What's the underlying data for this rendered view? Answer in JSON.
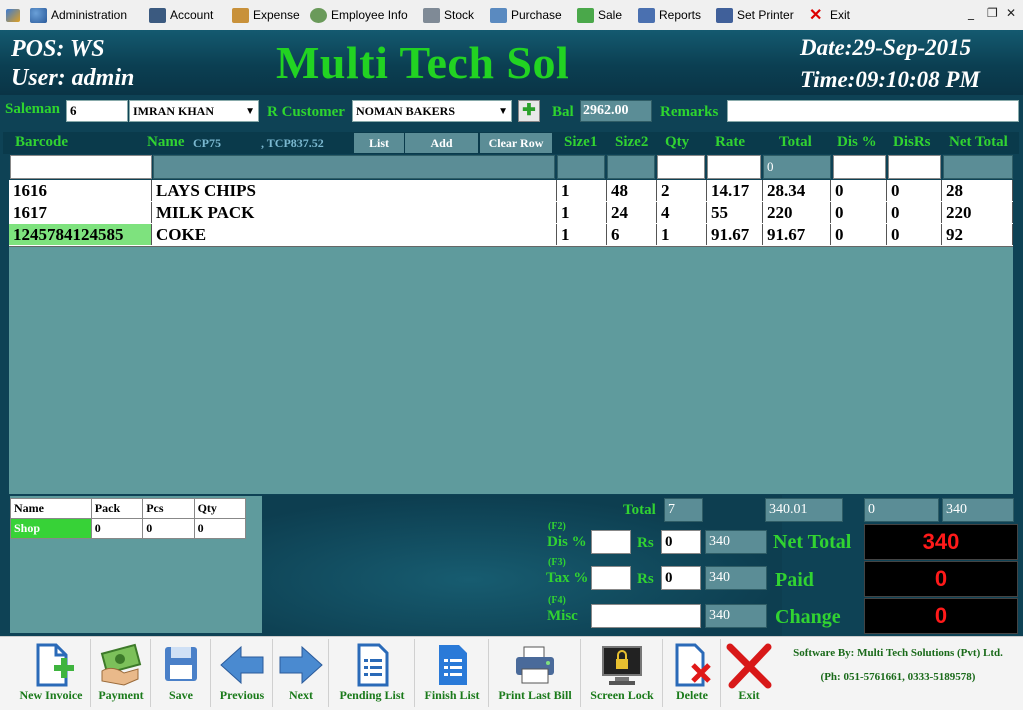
{
  "menu": {
    "items": [
      {
        "label": "Administration",
        "icon": "admin-users-icon"
      },
      {
        "label": "Account",
        "icon": "account-icon"
      },
      {
        "label": "Expense",
        "icon": "expense-box-icon"
      },
      {
        "label": "Employee Info",
        "icon": "employee-icon"
      },
      {
        "label": "Stock",
        "icon": "stock-cart-icon"
      },
      {
        "label": "Purchase",
        "icon": "purchase-icon"
      },
      {
        "label": "Sale",
        "icon": "sale-basket-icon"
      },
      {
        "label": "Reports",
        "icon": "reports-icon"
      },
      {
        "label": "Set Printer",
        "icon": "printer-icon"
      },
      {
        "label": "Exit",
        "icon": "exit-x-icon"
      }
    ],
    "minimize": "_",
    "restore": "❐",
    "close": "✕"
  },
  "header": {
    "pos": "POS: WS",
    "user": "User: admin",
    "title": "Multi Tech Sol",
    "date": "Date:29-Sep-2015",
    "time": "Time:09:10:08 PM"
  },
  "customer_bar": {
    "saleman_label": "Saleman",
    "saleman_id": "6",
    "saleman_name": "IMRAN KHAN",
    "customer_label": "R Customer",
    "customer_name": "NOMAN BAKERS",
    "add_symbol": "✚",
    "bal_label": "Bal",
    "bal_value": "2962.00",
    "remarks_label": "Remarks",
    "remarks_value": ""
  },
  "grid": {
    "headers": {
      "barcode": "Barcode",
      "name": "Name",
      "code": "CP75",
      "tcp": ", TCP837.52",
      "size1": "Size1",
      "size2": "Size2",
      "qty": "Qty",
      "rate": "Rate",
      "total": "Total",
      "dis_pct": "Dis %",
      "dis_rs": "DisRs",
      "net_total": "Net Total"
    },
    "buttons": {
      "list": "List",
      "add": "Add",
      "clear_row": "Clear Row"
    },
    "entry_total": "0",
    "rows": [
      {
        "barcode": "1616",
        "name": "LAYS CHIPS",
        "size1": "1",
        "size2": "48",
        "qty": "2",
        "rate": "14.17",
        "total": "28.34",
        "dis_pct": "0",
        "dis_rs": "0",
        "net": "28"
      },
      {
        "barcode": "1617",
        "name": "MILK PACK",
        "size1": "1",
        "size2": "24",
        "qty": "4",
        "rate": "55",
        "total": "220",
        "dis_pct": "0",
        "dis_rs": "0",
        "net": "220"
      },
      {
        "barcode": "1245784124585",
        "name": "COKE",
        "size1": "1",
        "size2": "6",
        "qty": "1",
        "rate": "91.67",
        "total": "91.67",
        "dis_pct": "0",
        "dis_rs": "0",
        "net": "92"
      }
    ]
  },
  "stock_table": {
    "headers": [
      "Name",
      "Pack",
      "Pcs",
      "Qty"
    ],
    "row": {
      "name": "Shop",
      "pack": "0",
      "pcs": "0",
      "qty": "0"
    }
  },
  "summary": {
    "total_label": "Total",
    "total_qty": "7",
    "total_amount": "340.01",
    "total_dis": "0",
    "total_net": "340",
    "dis_key": "(F2)",
    "dis_label": "Dis %",
    "dis_rs_label": "Rs",
    "dis_pct_value": "",
    "dis_rs_value": "0",
    "dis_result": "340",
    "tax_key": "(F3)",
    "tax_label": "Tax %",
    "tax_rs_label": "Rs",
    "tax_pct_value": "",
    "tax_rs_value": "0",
    "tax_result": "340",
    "misc_key": "(F4)",
    "misc_label": "Misc",
    "misc_value": "",
    "misc_result": "340",
    "net_total_label": "Net Total",
    "net_total_value": "340",
    "paid_label": "Paid",
    "paid_value": "0",
    "change_label": "Change",
    "change_value": "0"
  },
  "toolbar": {
    "new_invoice": "New Invoice",
    "payment": "Payment",
    "save": "Save",
    "previous": "Previous",
    "next": "Next",
    "pending_list": "Pending List",
    "finish_list": "Finish List",
    "print_last_bill": "Print Last Bill",
    "screen_lock": "Screen Lock",
    "delete": "Delete",
    "exit": "Exit",
    "credit_line1": "Software By: Multi Tech Solutions (Pvt) Ltd.",
    "credit_line2": "(Ph: 051-5761661, 0333-5189578)"
  },
  "colors": {
    "accent_green": "#22d322",
    "header_bg": "#0e4255",
    "grid_bg": "#5f9b9d",
    "alert_red": "#ff1a1a"
  }
}
